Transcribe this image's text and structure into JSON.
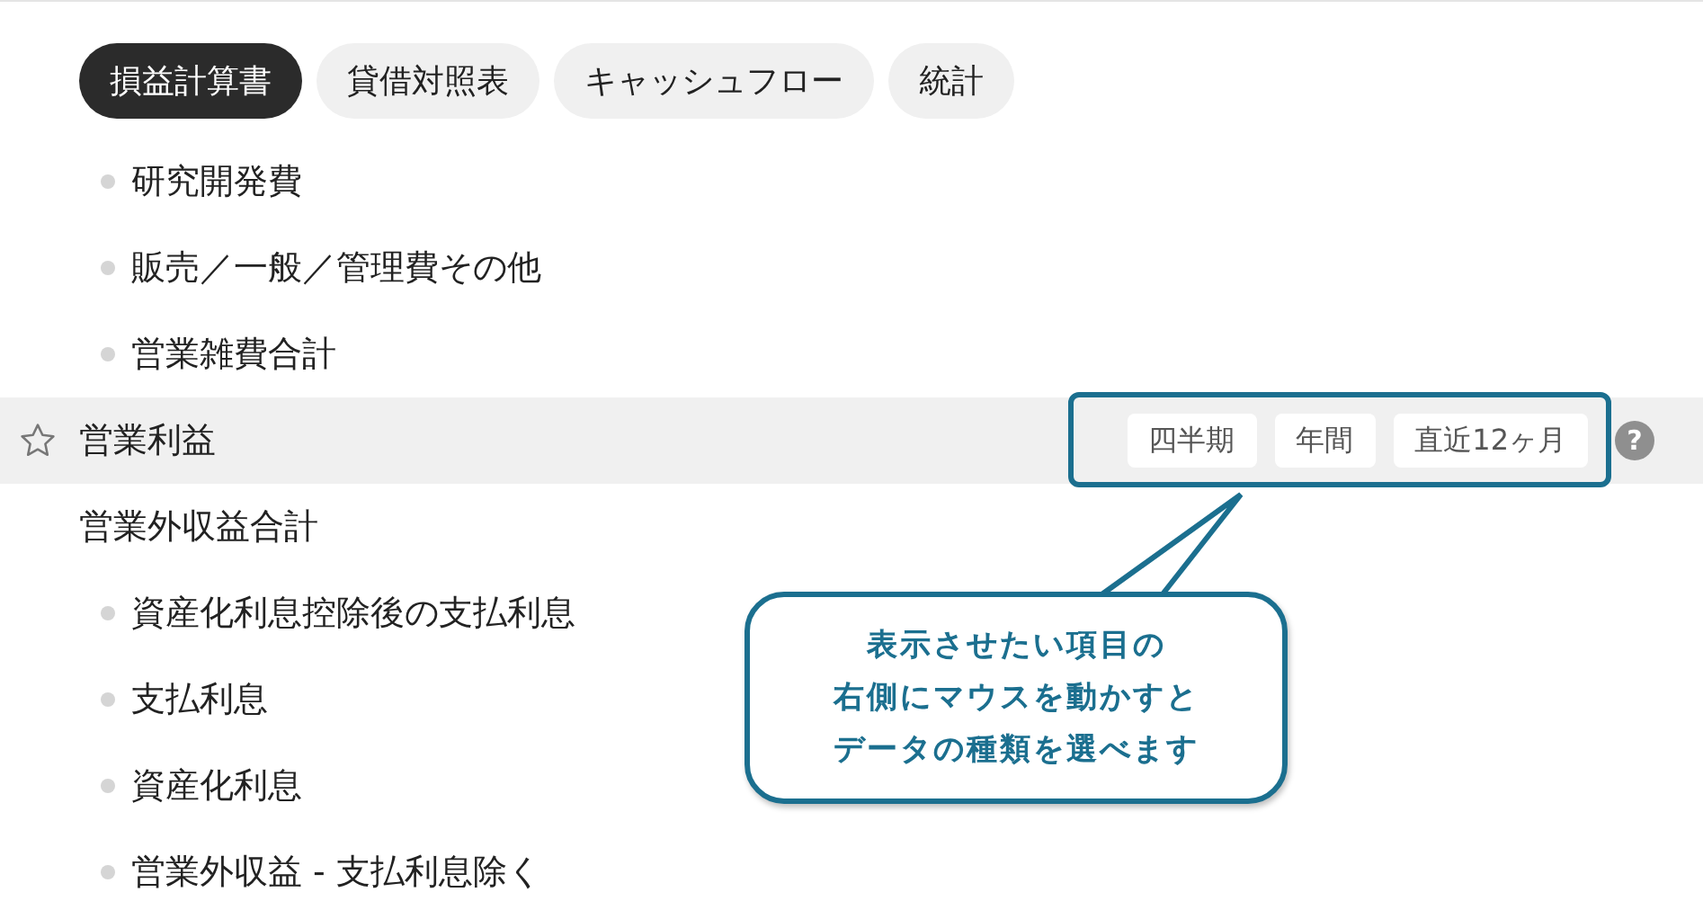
{
  "tabs": [
    {
      "label": "損益計算書",
      "selected": true
    },
    {
      "label": "貸借対照表",
      "selected": false
    },
    {
      "label": "キャッシュフロー",
      "selected": false
    },
    {
      "label": "統計",
      "selected": false
    }
  ],
  "rows": [
    {
      "kind": "bullet",
      "label": "研究開発費"
    },
    {
      "kind": "bullet",
      "label": "販売／一般／管理費その他"
    },
    {
      "kind": "bullet",
      "label": "営業雑費合計"
    },
    {
      "kind": "hovered",
      "label": "営業利益",
      "starred": false,
      "period_buttons": [
        "四半期",
        "年間",
        "直近12ヶ月"
      ],
      "help": "?"
    },
    {
      "kind": "plain",
      "label": "営業外収益合計"
    },
    {
      "kind": "bullet",
      "label": "資産化利息控除後の支払利息"
    },
    {
      "kind": "bullet",
      "label": "支払利息"
    },
    {
      "kind": "bullet",
      "label": "資産化利息"
    },
    {
      "kind": "bullet",
      "label": "営業外収益 - 支払利息除く"
    }
  ],
  "callout": {
    "lines": [
      "表示させたい項目の",
      "右側にマウスを動かすと",
      "データの種類を選べます"
    ]
  }
}
